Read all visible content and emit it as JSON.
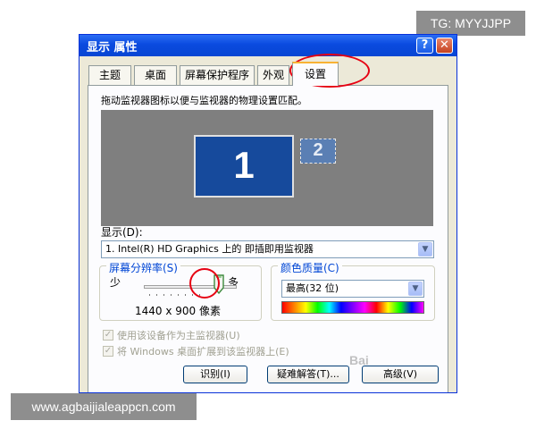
{
  "watermarks": {
    "top_right": "TG: MYYJJPP",
    "bottom_left": "www.agbaijialeappcn.com",
    "overlay_text": "Bai"
  },
  "window": {
    "title": "显示 属性",
    "help_label": "?",
    "close_label": "✕"
  },
  "tabs": [
    {
      "label": "主题",
      "active": false
    },
    {
      "label": "桌面",
      "active": false
    },
    {
      "label": "屏幕保护程序",
      "active": false
    },
    {
      "label": "外观",
      "active": false
    },
    {
      "label": "设置",
      "active": true
    }
  ],
  "settings": {
    "instruction": "拖动监视器图标以便与监视器的物理设置匹配。",
    "monitor1_label": "1",
    "monitor2_label": "2",
    "display_label": "显示(D):",
    "display_value": "1. Intel(R) HD Graphics 上的 即插即用监视器",
    "resolution": {
      "label": "屏幕分辨率(S)",
      "less": "少",
      "more": "多",
      "value": "1440 x 900 像素",
      "slider_level": 0.85
    },
    "color_quality": {
      "label": "颜色质量(C)",
      "value": "最高(32 位)"
    },
    "checkbox_primary": "使用该设备作为主监视器(U)",
    "checkbox_extend": "将 Windows 桌面扩展到该监视器上(E)",
    "buttons": {
      "identify": "识别(I)",
      "troubleshoot": "疑难解答(T)...",
      "advanced": "高级(V)"
    }
  },
  "colors": {
    "annotation": "#e60012",
    "titlebar": "#0a4adf",
    "monitor_primary": "#164a9c"
  }
}
